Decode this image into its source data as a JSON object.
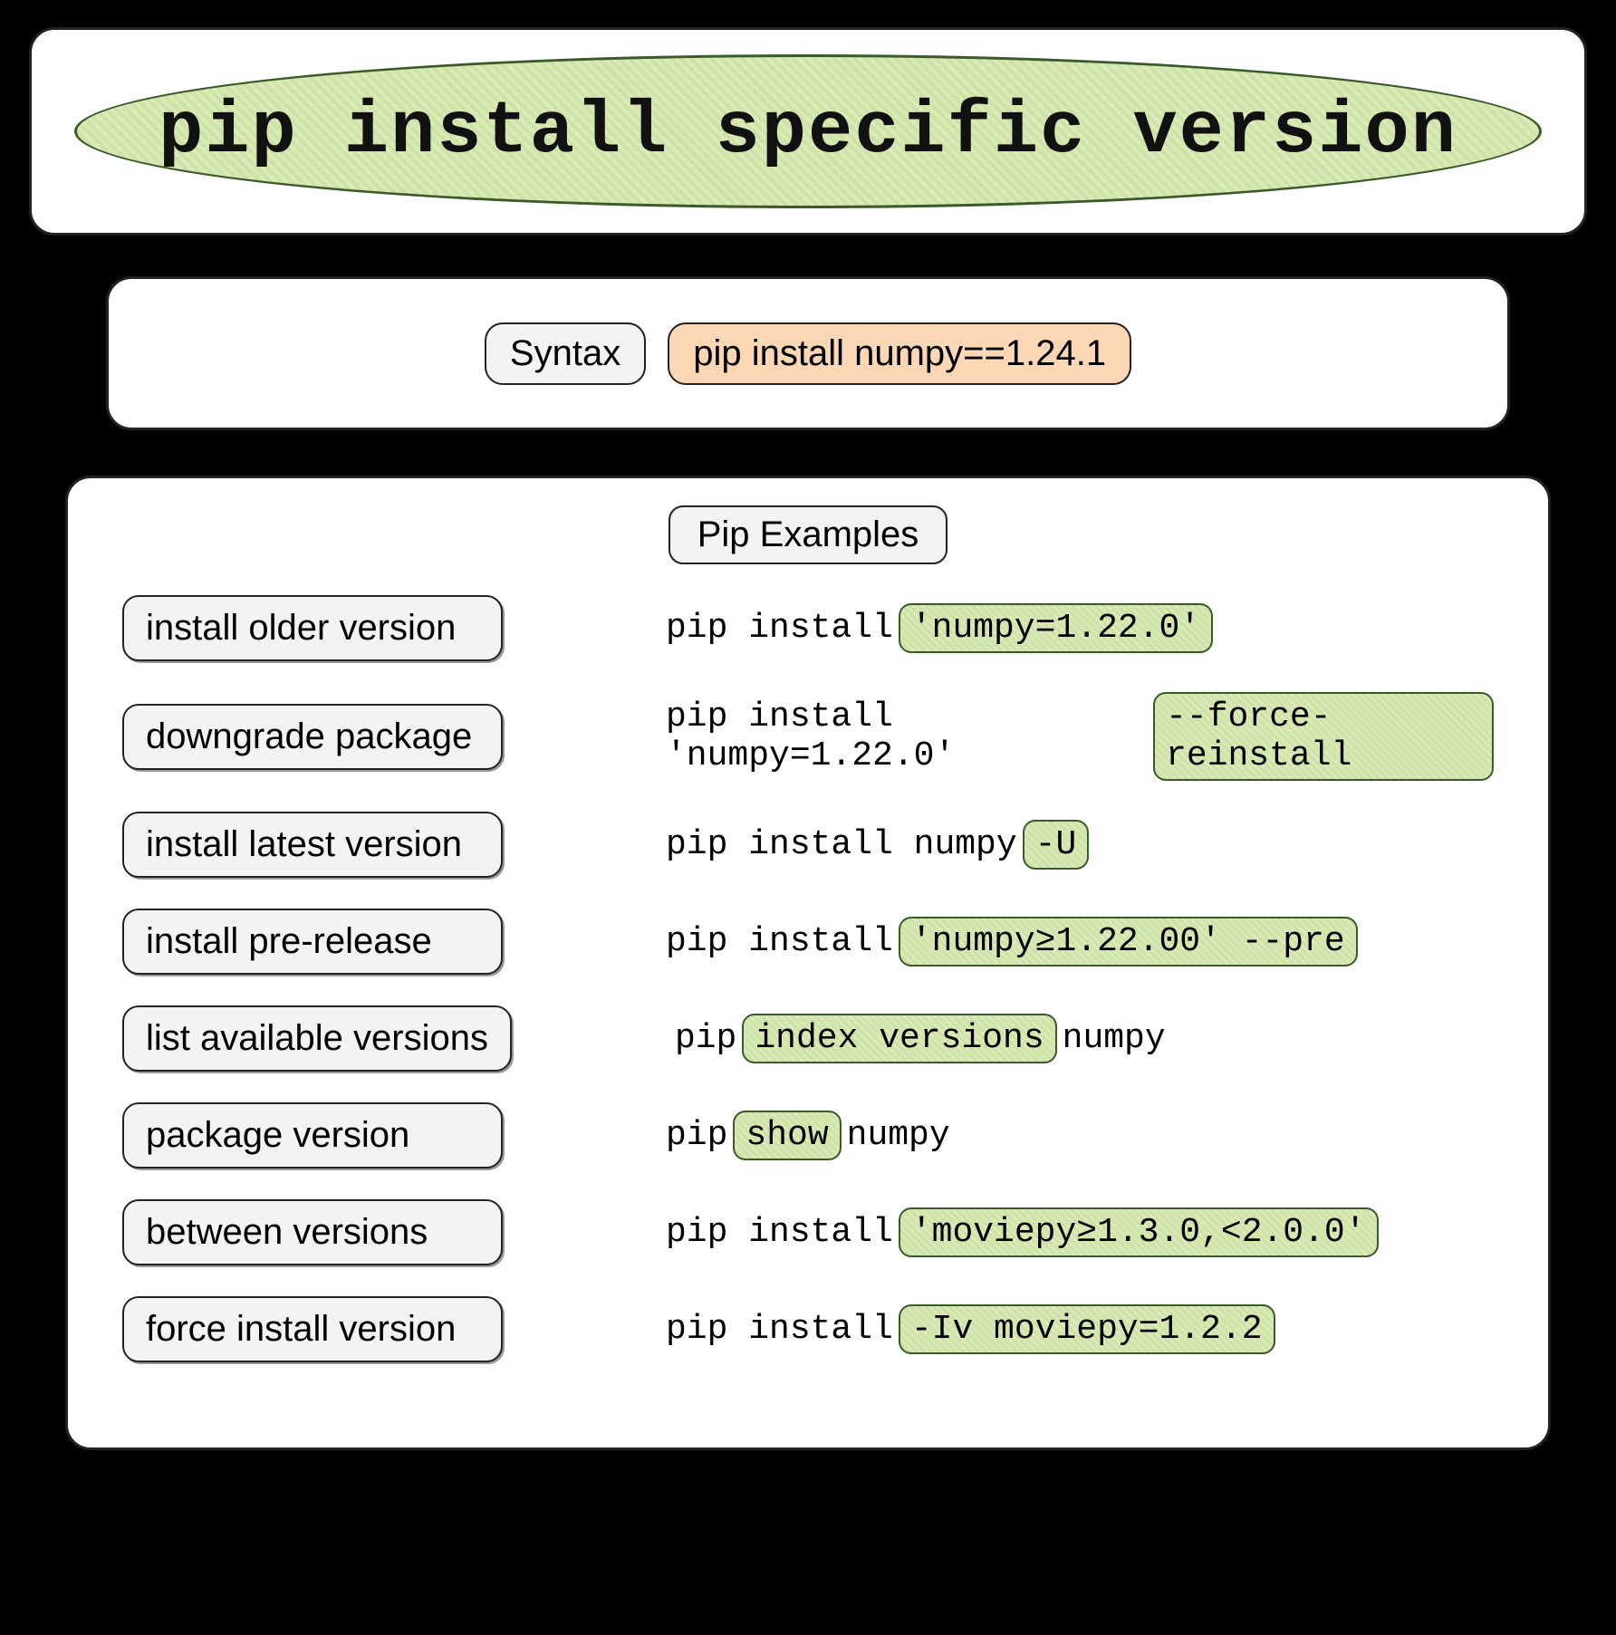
{
  "title": "pip install specific version",
  "syntax": {
    "label": "Syntax",
    "command": "pip install numpy==1.24.1"
  },
  "examples_header": "Pip Examples",
  "examples": [
    {
      "label": "install older version",
      "pre": "pip install ",
      "hl": "'numpy=1.22.0'",
      "post": ""
    },
    {
      "label": "downgrade package",
      "pre": "pip install 'numpy=1.22.0'",
      "hl": " --force-reinstall",
      "post": ""
    },
    {
      "label": "install latest version",
      "pre": "pip install numpy ",
      "hl": "-U",
      "post": ""
    },
    {
      "label": "install pre-release",
      "pre": "pip install ",
      "hl": "'numpy≥1.22.00' --pre",
      "post": ""
    },
    {
      "label": "list available versions",
      "pre": "pip ",
      "hl": "index versions",
      "post": " numpy"
    },
    {
      "label": "package version",
      "pre": "pip ",
      "hl": "show",
      "post": " numpy"
    },
    {
      "label": "between versions",
      "pre": "pip install ",
      "hl": "'moviepy≥1.3.0,<2.0.0'",
      "post": ""
    },
    {
      "label": "force install version",
      "pre": "pip install ",
      "hl": "-Iv moviepy=1.2.2",
      "post": ""
    }
  ]
}
